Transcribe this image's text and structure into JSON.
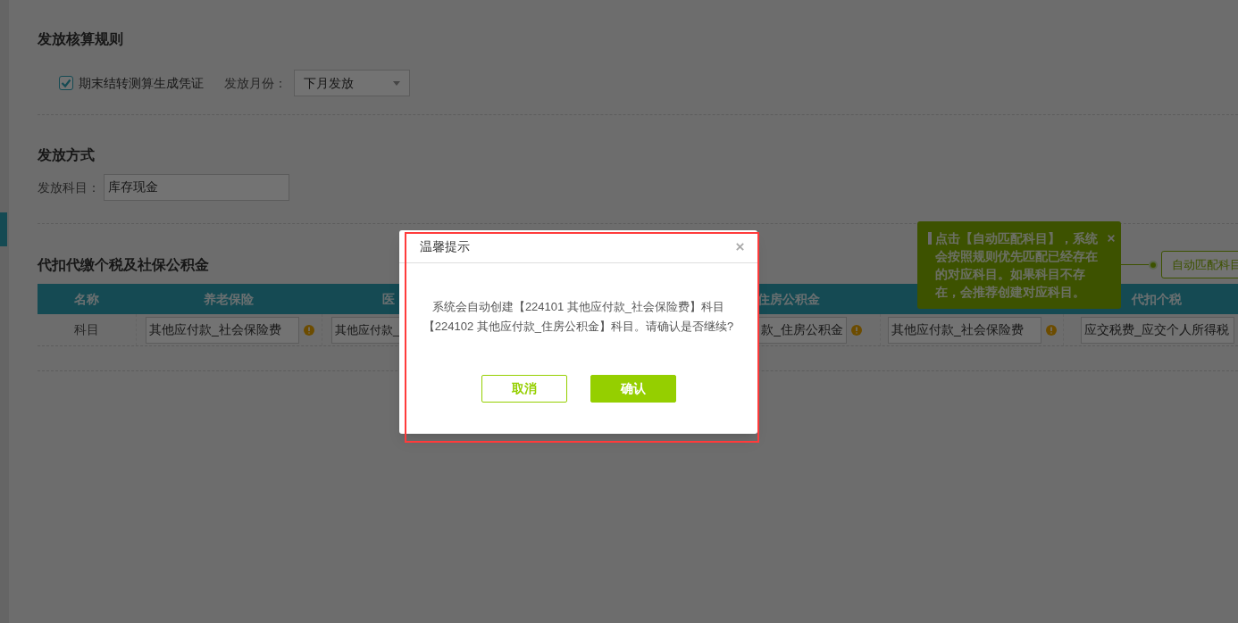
{
  "accounting_rules": {
    "title": "发放核算规则",
    "checkbox": {
      "label": "期末结转测算生成凭证",
      "checked": true
    },
    "month_label": "发放月份：",
    "month_select": {
      "value": "下月发放"
    }
  },
  "payment_method": {
    "title": "发放方式",
    "account_label": "发放科目：",
    "account_field": {
      "value": "库存现金"
    }
  },
  "withholding": {
    "title": "代扣代缴个税及社保公积金",
    "auto_match_button": "自动匹配科目",
    "tooltip": {
      "text": "点击【自动匹配科目】，系统会按照规则优先匹配已经存在的对应科目。如果科目不存在，会推荐创建对应科目。"
    },
    "table": {
      "columns": [
        {
          "label": "名称"
        },
        {
          "label": "养老保险"
        },
        {
          "label": "医"
        },
        {},
        {
          "label": "住房公积金"
        },
        {},
        {
          "label": "代扣个税"
        }
      ],
      "rows": [
        {
          "cells": [
            {
              "kind": "label",
              "text": "科目"
            },
            {
              "kind": "input",
              "value": "其他应付款_社会保险费",
              "warning": true
            },
            {
              "kind": "input",
              "value": "其他应付款_"
            },
            {
              "kind": "empty"
            },
            {
              "kind": "input",
              "value": "款_住房公积金",
              "warning": true
            },
            {
              "kind": "input",
              "value": "其他应付款_社会保险费",
              "warning": true
            },
            {
              "kind": "input",
              "value": "应交税费_应交个人所得税"
            }
          ]
        }
      ]
    }
  },
  "dialog": {
    "title": "温馨提示",
    "message_lines": [
      "系统会自动创建【224101 其他应付款_社会保险费】科目",
      "【224102 其他应付款_住房公积金】科目。请确认是否继续?"
    ],
    "buttons": [
      {
        "label": "取消",
        "kind": "secondary"
      },
      {
        "label": "确认",
        "kind": "primary"
      }
    ]
  }
}
